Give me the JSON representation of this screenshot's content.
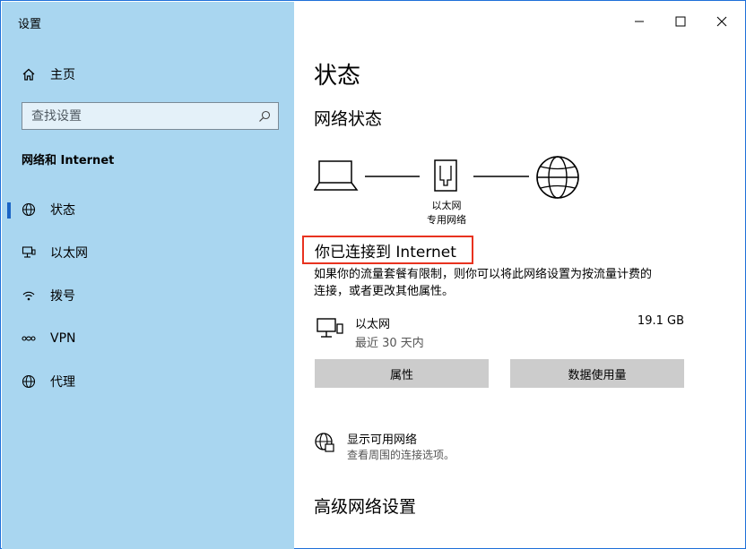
{
  "window": {
    "title": "设置"
  },
  "sidebar": {
    "home_label": "主页",
    "search_placeholder": "查找设置",
    "section_title": "网络和 Internet",
    "items": [
      {
        "label": "状态",
        "icon": "globe-status-icon",
        "active": true
      },
      {
        "label": "以太网",
        "icon": "ethernet-icon",
        "active": false
      },
      {
        "label": "拨号",
        "icon": "dialup-icon",
        "active": false
      },
      {
        "label": "VPN",
        "icon": "vpn-icon",
        "active": false
      },
      {
        "label": "代理",
        "icon": "proxy-globe-icon",
        "active": false
      }
    ]
  },
  "main": {
    "page_title": "状态",
    "network_status_heading": "网络状态",
    "diagram": {
      "adapter_line1": "以太网",
      "adapter_line2": "专用网络"
    },
    "connected_text": "你已连接到 Internet",
    "description_line1": "如果你的流量套餐有限制，则你可以将此网络设置为按流量计费的",
    "description_line2": "连接，或者更改其他属性。",
    "ethernet": {
      "name": "以太网",
      "subtitle": "最近 30 天内",
      "usage": "19.1 GB"
    },
    "buttons": {
      "properties": "属性",
      "data_usage": "数据使用量"
    },
    "show_networks": {
      "title": "显示可用网络",
      "subtitle": "查看周围的连接选项。"
    },
    "advanced_heading": "高级网络设置"
  },
  "colors": {
    "sidebar_bg": "#a9d6f0",
    "highlight_border": "#e8321f",
    "active_indicator": "#1a64c6",
    "button_bg": "#cccccc"
  }
}
